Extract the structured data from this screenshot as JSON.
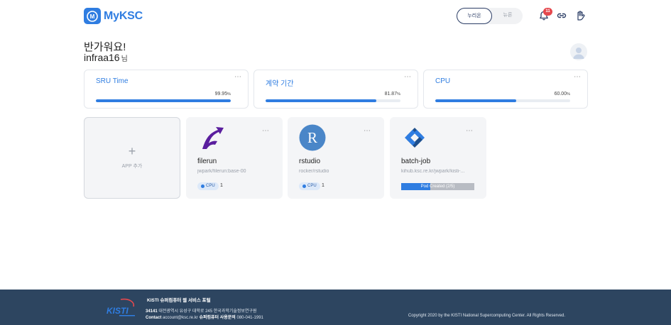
{
  "header": {
    "logo_text": "MyKSC",
    "segment": {
      "active": "누리온",
      "inactive": "뉴론"
    },
    "notification_count": "11",
    "brand_color": "#2f7de1"
  },
  "greeting": {
    "title": "반가워요!",
    "username": "infraa16",
    "suffix": "님"
  },
  "stats": [
    {
      "title": "SRU Time",
      "value": "99.95",
      "unit": "%",
      "percent": 99.95
    },
    {
      "title": "계약 기간",
      "value": "81.87",
      "unit": "%",
      "percent": 81.87
    },
    {
      "title": "CPU",
      "value": "60.00",
      "unit": "%",
      "percent": 60.0
    }
  ],
  "apps": {
    "add_label": "APP 추가",
    "items": [
      {
        "name": "filerun",
        "image": "jwpark/filerun:base-00",
        "chip": "CPU",
        "count": "1"
      },
      {
        "name": "rstudio",
        "image": "rocker/rstudio",
        "chip": "CPU",
        "count": "1",
        "logo_letter": "R"
      },
      {
        "name": "batch-job",
        "image": "kihub.ksc.re.kr/jwpark/kisti-...",
        "status": "Pod Created (2/5)",
        "progress": 0.4
      }
    ]
  },
  "footer": {
    "title": "KISTI 슈퍼컴퓨터 웹 서비스 포털",
    "address_label": "34141",
    "address": "대전광역시 유성구 대학로 245 한국과학기술정보연구원",
    "contact_label": "Contact",
    "contact_email": "account@ksc.re.kr",
    "contact_phone_label": "슈퍼컴퓨터 사용문의",
    "contact_phone": "080-041-1991",
    "copyright": "Copyright 2020 by the KISTI National Supercomputing Center. All Rights Reserved."
  }
}
